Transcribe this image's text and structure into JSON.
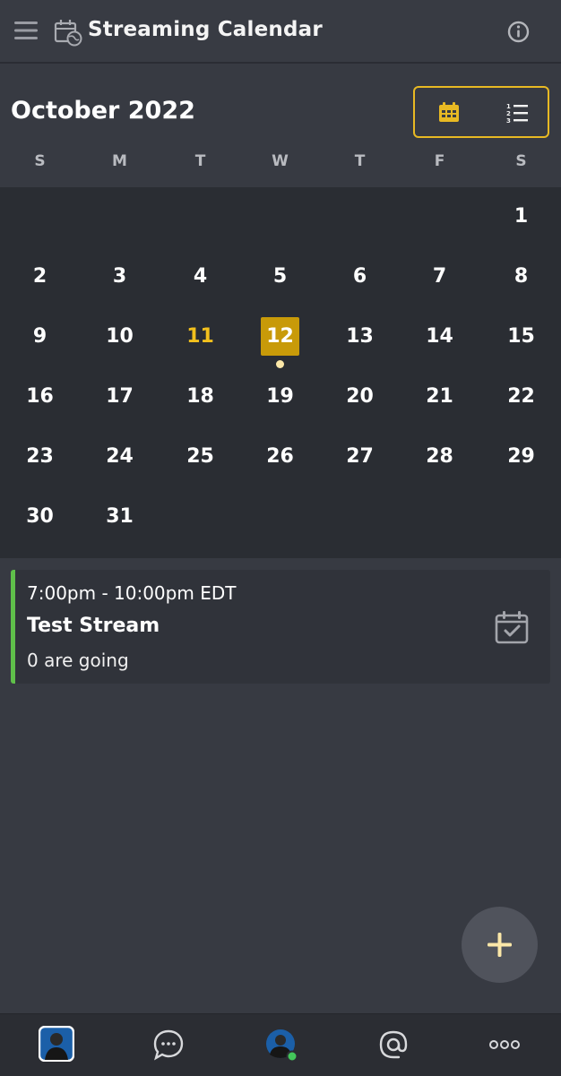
{
  "header": {
    "title": "Streaming Calendar",
    "menu_icon": "hamburger-menu-icon",
    "app_icon": "calendar-globe-icon",
    "info_icon": "info-icon"
  },
  "calendar": {
    "month_title": "October 2022",
    "view_toggle": {
      "calendar_view_icon": "calendar-grid-icon",
      "list_view_icon": "numbered-list-icon",
      "active": "calendar"
    },
    "weekdays": [
      "S",
      "M",
      "T",
      "W",
      "T",
      "F",
      "S"
    ],
    "weeks": [
      [
        "",
        "",
        "",
        "",
        "",
        "",
        "1"
      ],
      [
        "2",
        "3",
        "4",
        "5",
        "6",
        "7",
        "8"
      ],
      [
        "9",
        "10",
        "11",
        "12",
        "13",
        "14",
        "15"
      ],
      [
        "16",
        "17",
        "18",
        "19",
        "20",
        "21",
        "22"
      ],
      [
        "23",
        "24",
        "25",
        "26",
        "27",
        "28",
        "29"
      ],
      [
        "30",
        "31",
        "",
        "",
        "",
        "",
        ""
      ]
    ],
    "selected_day": "12",
    "highlighted_day": "11",
    "days_with_events": [
      "12"
    ],
    "colors": {
      "accent": "#e8b923",
      "selected_bg": "#c89a09",
      "event_dot": "#fbe7a8"
    }
  },
  "event": {
    "time": "7:00pm - 10:00pm EDT",
    "title": "Test Stream",
    "going": "0 are going",
    "rsvp_icon": "calendar-check-icon",
    "accent_color": "#5fbf4a"
  },
  "fab": {
    "icon": "plus-icon"
  },
  "bottom_nav": {
    "items": [
      {
        "name": "server-avatar",
        "icon": "server-avatar-icon"
      },
      {
        "name": "messages",
        "icon": "chat-bubble-icon"
      },
      {
        "name": "profile",
        "icon": "user-avatar-icon",
        "status": "online"
      },
      {
        "name": "mentions",
        "icon": "at-sign-icon"
      },
      {
        "name": "more",
        "icon": "more-dots-icon"
      }
    ]
  }
}
